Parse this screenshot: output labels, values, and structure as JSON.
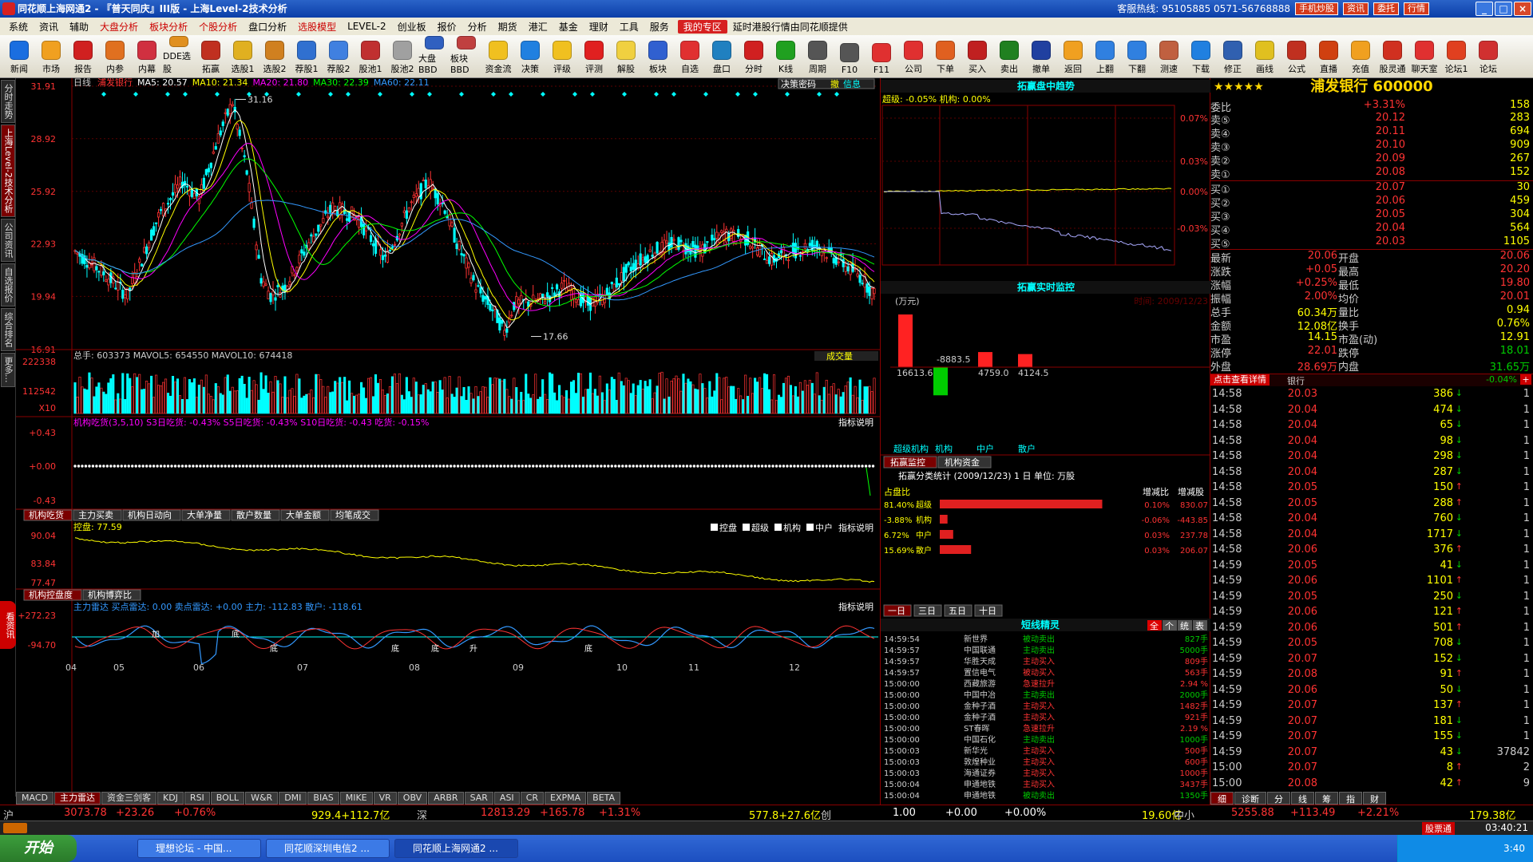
{
  "titlebar": {
    "title": "同花顺上海网通2 - 『普天同庆』III版 - 上海Level-2技术分析",
    "hotline": "客服热线: 95105885 0571-56768888",
    "buttons": [
      "手机炒股",
      "资讯",
      "委托",
      "行情"
    ]
  },
  "menu": [
    "系统",
    "资讯",
    "辅助",
    "大盘分析",
    "板块分析",
    "个股分析",
    "盘口分析",
    "选股模型",
    "LEVEL-2",
    "创业板",
    "报价",
    "分析",
    "期货",
    "港汇",
    "基金",
    "理财",
    "工具",
    "服务",
    "我的专区",
    "延时港股行情由同花顺提供"
  ],
  "menu_red": [
    "大盘分析",
    "板块分析",
    "个股分析",
    "选股模型"
  ],
  "toolbar": [
    "新闻",
    "市场",
    "报告",
    "内参",
    "内幕",
    "DDE选股",
    "拓赢",
    "选股1",
    "选股2",
    "荐股1",
    "荐股2",
    "股池1",
    "股池2",
    "大盘BBD",
    "板块BBD",
    "资金流",
    "决策",
    "评级",
    "评测",
    "解股",
    "板块",
    "自选",
    "盘口",
    "分时",
    "K线",
    "周期",
    "F10",
    "F11",
    "公司",
    "下单",
    "买入",
    "卖出",
    "撤单",
    "返回",
    "上翻",
    "下翻",
    "测速",
    "下载",
    "修正",
    "画线",
    "公式",
    "直播",
    "充值",
    "股灵通",
    "聊天室",
    "论坛1",
    "论坛"
  ],
  "leftstrip": [
    "分时走势",
    "上海Level-2技术分析",
    "公司资讯",
    "自选报价",
    "综合排名",
    "更多..."
  ],
  "leftstrip_kan": "看资讯",
  "chart": {
    "header_period": "日线",
    "header_stock": "浦发银行",
    "ma": [
      "MA5: 20.57",
      "MA10: 21.34",
      "MA20: 21.80",
      "MA30: 22.39",
      "MA60: 22.11"
    ],
    "top_right_label": "决策密码",
    "top_right_btns": [
      "撤",
      "信息"
    ],
    "price_ticks": [
      "31.91",
      "28.92",
      "25.92",
      "22.93",
      "19.94",
      "16.91"
    ],
    "high_label": "31.16",
    "low_label": "17.66",
    "volume_header": "总手: 603373  MAVOL5: 654550  MAVOL10: 674418",
    "volume_type": "成交量",
    "volume_ticks": [
      "222338",
      "112542",
      "X10"
    ],
    "ind1_header": "机构吃货(3,5,10)  S3日吃货: -0.43%  S5日吃货: -0.43%  S10日吃货: -0.43  吃货: -0.15%",
    "ind1_desc": "指标说明",
    "ind1_ticks": [
      "+0.43",
      "+0.00",
      "-0.43"
    ],
    "ind1_tabs": [
      "机构吃货",
      "主力买卖",
      "机构日动向",
      "大单净量",
      "散户数量",
      "大单金额",
      "均笔成交"
    ],
    "ind2_header": "控盘: 77.59",
    "ind2_checks": [
      "控盘",
      "超级",
      "机构",
      "中户"
    ],
    "ind2_desc": "指标说明",
    "ind2_ticks": [
      "90.04",
      "83.84",
      "77.47"
    ],
    "ind2_tabs": [
      "机构控盘度",
      "机构博弈比"
    ],
    "ind3_header": "主力雷达  买点雷达: 0.00  卖点雷达: +0.00  主力: -112.83  散户: -118.61",
    "ind3_desc": "指标说明",
    "ind3_ticks": [
      "+272.23",
      "-94.70"
    ],
    "ind3_marks": [
      "加",
      "底",
      "底",
      "底",
      "底",
      "升",
      "底"
    ],
    "months": [
      "04",
      "05",
      "06",
      "07",
      "08",
      "09",
      "10",
      "11",
      "12"
    ],
    "bottom_tabs": [
      "MACD",
      "主力雷达",
      "资金三剑客",
      "KDJ",
      "RSI",
      "BOLL",
      "W&R",
      "DMI",
      "BIAS",
      "MIKE",
      "VR",
      "OBV",
      "ARBR",
      "SAR",
      "ASI",
      "CR",
      "EXPMA",
      "BETA"
    ]
  },
  "mid": {
    "trend_title": "拓赢盘中趋势",
    "trend_legend": "超级: -0.05%  机构: 0.00%",
    "trend_ticks": [
      "0.07%",
      "0.03%",
      "0.00%",
      "-0.03%"
    ],
    "monitor_title": "拓赢实时监控",
    "monitor_unit": "(万元)",
    "monitor_time": "时间: 2009/12/23",
    "monitor_values": [
      "16613.6",
      "-8883.5",
      "4759.0",
      "4124.5"
    ],
    "monitor_bars": [
      16613.6,
      -8883.5,
      4759.0,
      4124.5
    ],
    "monitor_cats": [
      "超级机构",
      "机构",
      "中户",
      "散户"
    ],
    "stat_tabs": [
      "拓赢监控",
      "机构资金"
    ],
    "stat_title": "拓赢分类统计 (2009/12/23)  1        日        单位: 万股",
    "stat_cols": [
      "占盘比",
      "增减比",
      "增减股"
    ],
    "stat_rows": [
      {
        "pct": "81.40%",
        "name": "超级",
        "bar": 0.814,
        "chg": "0.10%",
        "shares": "830.07"
      },
      {
        "pct": "-3.88%",
        "name": "机构",
        "bar": 0.0388,
        "chg": "-0.06%",
        "shares": "-443.85"
      },
      {
        "pct": "6.72%",
        "name": "中户",
        "bar": 0.0672,
        "chg": "0.03%",
        "shares": "237.78"
      },
      {
        "pct": "15.69%",
        "name": "散户",
        "bar": 0.1569,
        "chg": "0.03%",
        "shares": "206.07"
      }
    ],
    "period_tabs": [
      "一日",
      "三日",
      "五日",
      "十日"
    ],
    "sprite_title": "短线精灵",
    "sprite_btns": [
      "全",
      "个",
      "统",
      "表"
    ],
    "sprite": [
      [
        "14:59:54",
        "新世界",
        "被动卖出",
        "827手"
      ],
      [
        "14:59:57",
        "中国联通",
        "主动卖出",
        "5000手"
      ],
      [
        "14:59:57",
        "华胜天成",
        "主动买入",
        "809手"
      ],
      [
        "14:59:57",
        "置信电气",
        "被动买入",
        "563手"
      ],
      [
        "15:00:00",
        "西藏旅游",
        "急速拉升",
        "2.94 %"
      ],
      [
        "15:00:00",
        "中国中冶",
        "主动卖出",
        "2000手"
      ],
      [
        "15:00:00",
        "金种子酒",
        "主动买入",
        "1482手"
      ],
      [
        "15:00:00",
        "金种子酒",
        "主动买入",
        "921手"
      ],
      [
        "15:00:00",
        "ST春晖",
        "急速拉升",
        "2.19 %"
      ],
      [
        "15:00:00",
        "中国石化",
        "主动卖出",
        "1000手"
      ],
      [
        "15:00:03",
        "新华光",
        "主动买入",
        "500手"
      ],
      [
        "15:00:03",
        "敦煌种业",
        "主动买入",
        "600手"
      ],
      [
        "15:00:03",
        "海通证券",
        "主动买入",
        "1000手"
      ],
      [
        "15:00:04",
        "申通地铁",
        "主动买入",
        "3437手"
      ],
      [
        "15:00:04",
        "申通地铁",
        "被动卖出",
        "1350手"
      ]
    ]
  },
  "right": {
    "stars": "★★★★★",
    "stock_name": "浦发银行 600000",
    "weibi": {
      "k": "委比",
      "v": "+3.31%",
      "vol": "158"
    },
    "asks": [
      [
        "卖⑤",
        "20.12",
        "283"
      ],
      [
        "卖④",
        "20.11",
        "694"
      ],
      [
        "卖③",
        "20.10",
        "909"
      ],
      [
        "卖②",
        "20.09",
        "267"
      ],
      [
        "卖①",
        "20.08",
        "152"
      ]
    ],
    "bids": [
      [
        "买①",
        "20.07",
        "30"
      ],
      [
        "买②",
        "20.06",
        "459"
      ],
      [
        "买③",
        "20.05",
        "304"
      ],
      [
        "买④",
        "20.04",
        "564"
      ],
      [
        "买⑤",
        "20.03",
        "1105"
      ]
    ],
    "stats": [
      [
        "最新",
        "20.06",
        "开盘",
        "20.06"
      ],
      [
        "涨跌",
        "+0.05",
        "最高",
        "20.20"
      ],
      [
        "涨幅",
        "+0.25%",
        "最低",
        "19.80"
      ],
      [
        "振幅",
        "2.00%",
        "均价",
        "20.01"
      ],
      [
        "总手",
        "60.34万",
        "量比",
        "0.94"
      ],
      [
        "金额",
        "12.08亿",
        "换手",
        "0.76%"
      ],
      [
        "市盈",
        "14.15",
        "市盈(动)",
        "12.91"
      ],
      [
        "涨停",
        "22.01",
        "跌停",
        "18.01"
      ],
      [
        "外盘",
        "28.69万",
        "内盘",
        "31.65万"
      ]
    ],
    "sector_btn": "点击查看详情",
    "sector": "银行",
    "sector_chg": "-0.04%",
    "ticks": [
      [
        "14:58",
        "20.03",
        "386",
        "down",
        "1"
      ],
      [
        "14:58",
        "20.04",
        "474",
        "down",
        "1"
      ],
      [
        "14:58",
        "20.04",
        "65",
        "down",
        "1"
      ],
      [
        "14:58",
        "20.04",
        "98",
        "down",
        "1"
      ],
      [
        "14:58",
        "20.04",
        "298",
        "down",
        "1"
      ],
      [
        "14:58",
        "20.04",
        "287",
        "down",
        "1"
      ],
      [
        "14:58",
        "20.05",
        "150",
        "up",
        "1"
      ],
      [
        "14:58",
        "20.05",
        "288",
        "up",
        "1"
      ],
      [
        "14:58",
        "20.04",
        "760",
        "down",
        "1"
      ],
      [
        "14:58",
        "20.04",
        "1717",
        "down",
        "1"
      ],
      [
        "14:58",
        "20.06",
        "376",
        "up",
        "1"
      ],
      [
        "14:59",
        "20.05",
        "41",
        "down",
        "1"
      ],
      [
        "14:59",
        "20.06",
        "1101",
        "up",
        "1"
      ],
      [
        "14:59",
        "20.05",
        "250",
        "down",
        "1"
      ],
      [
        "14:59",
        "20.06",
        "121",
        "up",
        "1"
      ],
      [
        "14:59",
        "20.06",
        "501",
        "up",
        "1"
      ],
      [
        "14:59",
        "20.05",
        "708",
        "down",
        "1"
      ],
      [
        "14:59",
        "20.07",
        "152",
        "down",
        "1"
      ],
      [
        "14:59",
        "20.08",
        "91",
        "up",
        "1"
      ],
      [
        "14:59",
        "20.06",
        "50",
        "down",
        "1"
      ],
      [
        "14:59",
        "20.07",
        "137",
        "up",
        "1"
      ],
      [
        "14:59",
        "20.07",
        "181",
        "down",
        "1"
      ],
      [
        "14:59",
        "20.07",
        "155",
        "down",
        "1"
      ],
      [
        "14:59",
        "20.07",
        "43",
        "down",
        "37842"
      ],
      [
        "15:00",
        "20.07",
        "8",
        "up",
        "2"
      ],
      [
        "15:00",
        "20.08",
        "42",
        "up",
        "9"
      ]
    ],
    "bottom_tabs": [
      "细",
      "诊断",
      "分",
      "线",
      "筹",
      "指",
      "财"
    ]
  },
  "status": {
    "sh_label": "沪",
    "sh_index": "3073.78",
    "sh_chg": "+23.26",
    "sh_pct": "+0.76%",
    "sh_amt": "929.4+112.7亿",
    "sz_label": "深",
    "sz_index": "12813.29",
    "sz_chg": "+165.78",
    "sz_pct": "+1.31%",
    "cy_amt": "577.8+27.6亿",
    "cy_label": "创",
    "cy_index": "1.00",
    "cy_chg": "+0.00",
    "cy_pct": "+0.00%",
    "zx_amt": "19.60亿",
    "zx_label": "中小",
    "zx_index": "5255.88",
    "zx_chg": "+113.49",
    "zx_pct": "+2.21%",
    "zx_amt2": "179.38亿",
    "time": "03:40:21",
    "btn": "股票通"
  },
  "taskbar": {
    "start": "开始",
    "tasks": [
      "理想论坛 - 中国...",
      "同花顺深圳电信2 ...",
      "同花顺上海网通2 ..."
    ],
    "tray": "3:40"
  },
  "colors": {
    "up": "#ff3333",
    "down": "#00e000",
    "accent": "#8a0000"
  }
}
